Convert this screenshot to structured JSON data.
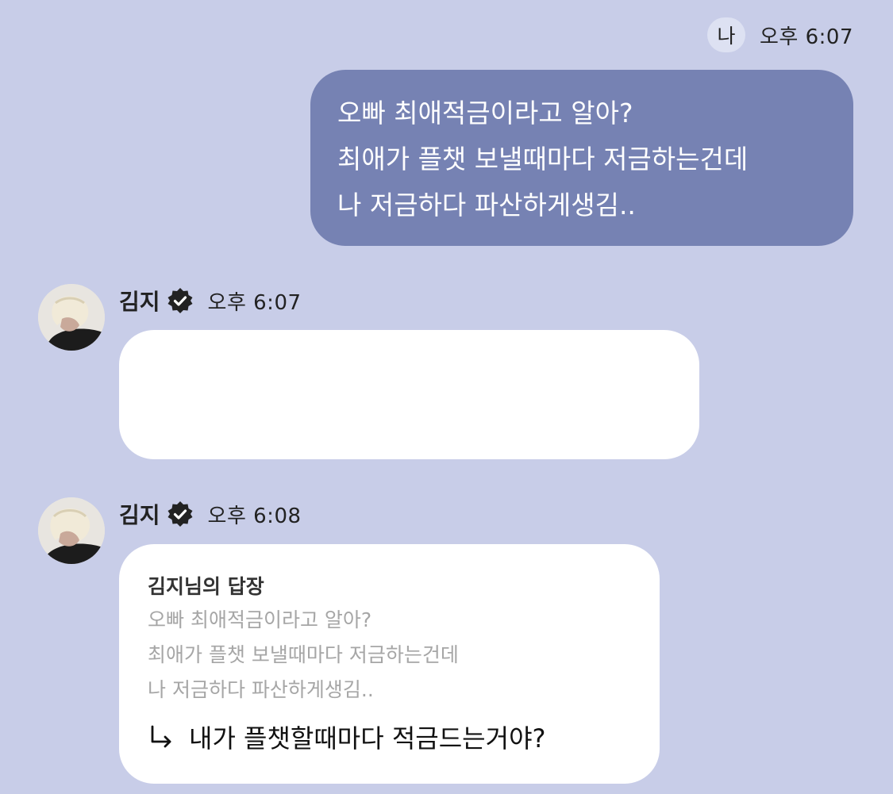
{
  "my_message": {
    "sender_label": "나",
    "time": "오후 6:07",
    "lines": [
      "오빠 최애적금이라고 알아?",
      "최애가 플챗 보낼때마다 저금하는건데",
      "나 저금하다 파산하게생김.."
    ],
    "bubble_color": "#7682b3"
  },
  "artist_messages": [
    {
      "name": "김지",
      "time": "오후 6:07",
      "avatar_icon": "artist-avatar"
    },
    {
      "name": "김지",
      "time": "오후 6:08",
      "avatar_icon": "artist-avatar",
      "reply_title": "김지님의 답장",
      "quoted_lines": [
        "오빠 최애적금이라고 알아?",
        "최애가 플챗 보낼때마다 저금하는건데",
        "나 저금하다 파산하게생김.."
      ],
      "reply_text": "내가 플챗할때마다 적금드는거야?"
    }
  ],
  "colors": {
    "background": "#c8cde8",
    "artist_bubble": "#ffffff",
    "quoted_text": "#a6a6a6"
  }
}
